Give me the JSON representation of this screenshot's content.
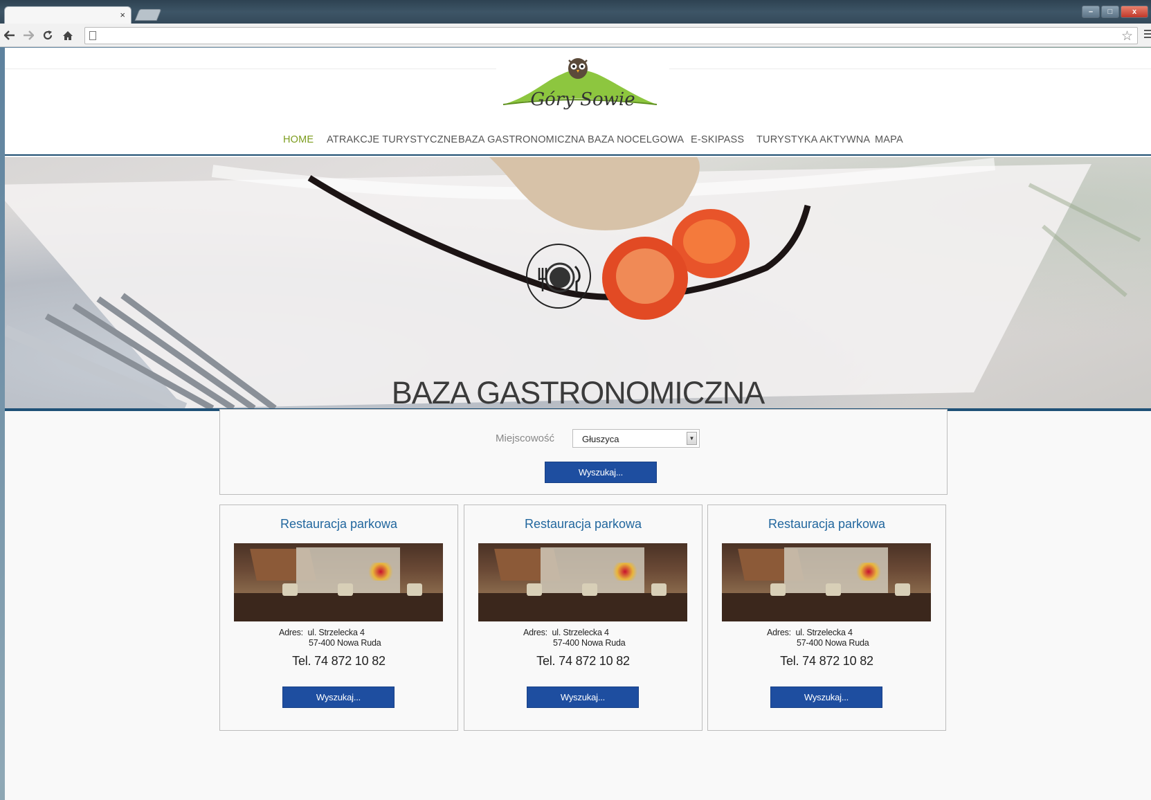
{
  "browser": {
    "tab_close": "×",
    "window_controls": {
      "minimize": "–",
      "maximize": "□",
      "close": "x"
    },
    "nav_icons": [
      "back-arrow-icon",
      "forward-arrow-icon",
      "reload-icon",
      "home-icon"
    ],
    "address_value": ""
  },
  "site": {
    "logo_text": "Góry Sowie",
    "nav": [
      {
        "label": "HOME",
        "active": true
      },
      {
        "label": "ATRAKCJE TURYSTYCZNE"
      },
      {
        "label": "BAZA GASTRONOMICZNA"
      },
      {
        "label": "BAZA NOCELGOWA"
      },
      {
        "label": "E-SKIPASS"
      },
      {
        "label": "TURYSTYKA AKTYWNA"
      },
      {
        "label": "MAPA"
      }
    ],
    "hero_title": "BAZA GASTRONOMICZNA",
    "search": {
      "label": "Miejscowość",
      "selected": "Głuszyca",
      "button": "Wyszukaj..."
    },
    "cards": [
      {
        "title": "Restauracja parkowa",
        "address_label": "Adres:",
        "address_line1": "ul. Strzelecka 4",
        "address_line2": "57-400 Nowa Ruda",
        "phone": "Tel. 74 872 10 82",
        "button": "Wyszukaj..."
      },
      {
        "title": "Restauracja parkowa",
        "address_label": "Adres:",
        "address_line1": "ul. Strzelecka 4",
        "address_line2": "57-400 Nowa Ruda",
        "phone": "Tel. 74 872 10 82",
        "button": "Wyszukaj..."
      },
      {
        "title": "Restauracja parkowa",
        "address_label": "Adres:",
        "address_line1": "ul. Strzelecka 4",
        "address_line2": "57-400 Nowa Ruda",
        "phone": "Tel. 74 872 10 82",
        "button": "Wyszukaj..."
      }
    ]
  },
  "colors": {
    "nav_active": "#7c9c1e",
    "button_blue": "#1e4ea0",
    "card_title": "#22679e",
    "header_border": "#1e4f72"
  }
}
